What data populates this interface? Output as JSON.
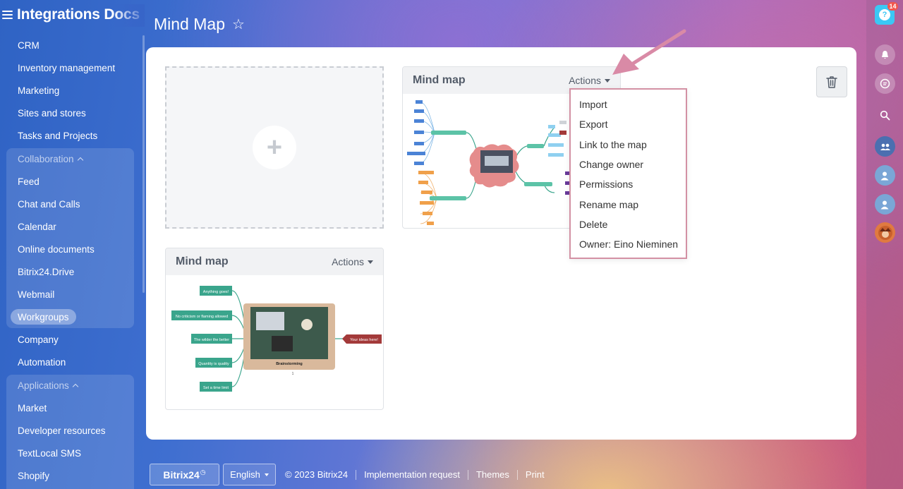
{
  "sidebar": {
    "brand": "Integrations Docs",
    "items_top": [
      "CRM",
      "Inventory management",
      "Marketing",
      "Sites and stores",
      "Tasks and Projects"
    ],
    "collaboration": {
      "title": "Collaboration",
      "items": [
        "Feed",
        "Chat and Calls",
        "Calendar",
        "Online documents",
        "Bitrix24.Drive",
        "Webmail",
        "Workgroups"
      ]
    },
    "items_mid": [
      "Company",
      "Automation"
    ],
    "applications": {
      "title": "Applications",
      "items": [
        "Market",
        "Developer resources",
        "TextLocal SMS",
        "Shopify"
      ]
    },
    "active_item": "Workgroups"
  },
  "header": {
    "title": "Mind Map",
    "star_icon": "star-outline-icon"
  },
  "maps": [
    {
      "title": "Mind map",
      "actions_label": "Actions"
    },
    {
      "title": "Mind map",
      "actions_label": "Actions",
      "preview": {
        "nodes_left": [
          "Anything goes!",
          "No criticism or flaming allowed",
          "The wilder the better",
          "Quantity is quality",
          "Set a time limit"
        ],
        "center": "Brainstorming",
        "node_right": "Your ideas here!",
        "count": "1"
      }
    }
  ],
  "dropdown": {
    "items": [
      "Import",
      "Export",
      "Link to the map",
      "Change owner",
      "Permissions",
      "Rename map",
      "Delete",
      "Owner: Eino Nieminen"
    ]
  },
  "rightbar": {
    "notifications_count": "14"
  },
  "footer": {
    "logo": "Bitrix24",
    "language": "English",
    "copyright": "© 2023 Bitrix24",
    "links": [
      "Implementation request",
      "Themes",
      "Print"
    ]
  },
  "colors": {
    "accent_pink": "#d391a4",
    "node_green": "#3aa58c",
    "node_red": "#a33a3a",
    "help_blue": "#3bc8f5"
  }
}
